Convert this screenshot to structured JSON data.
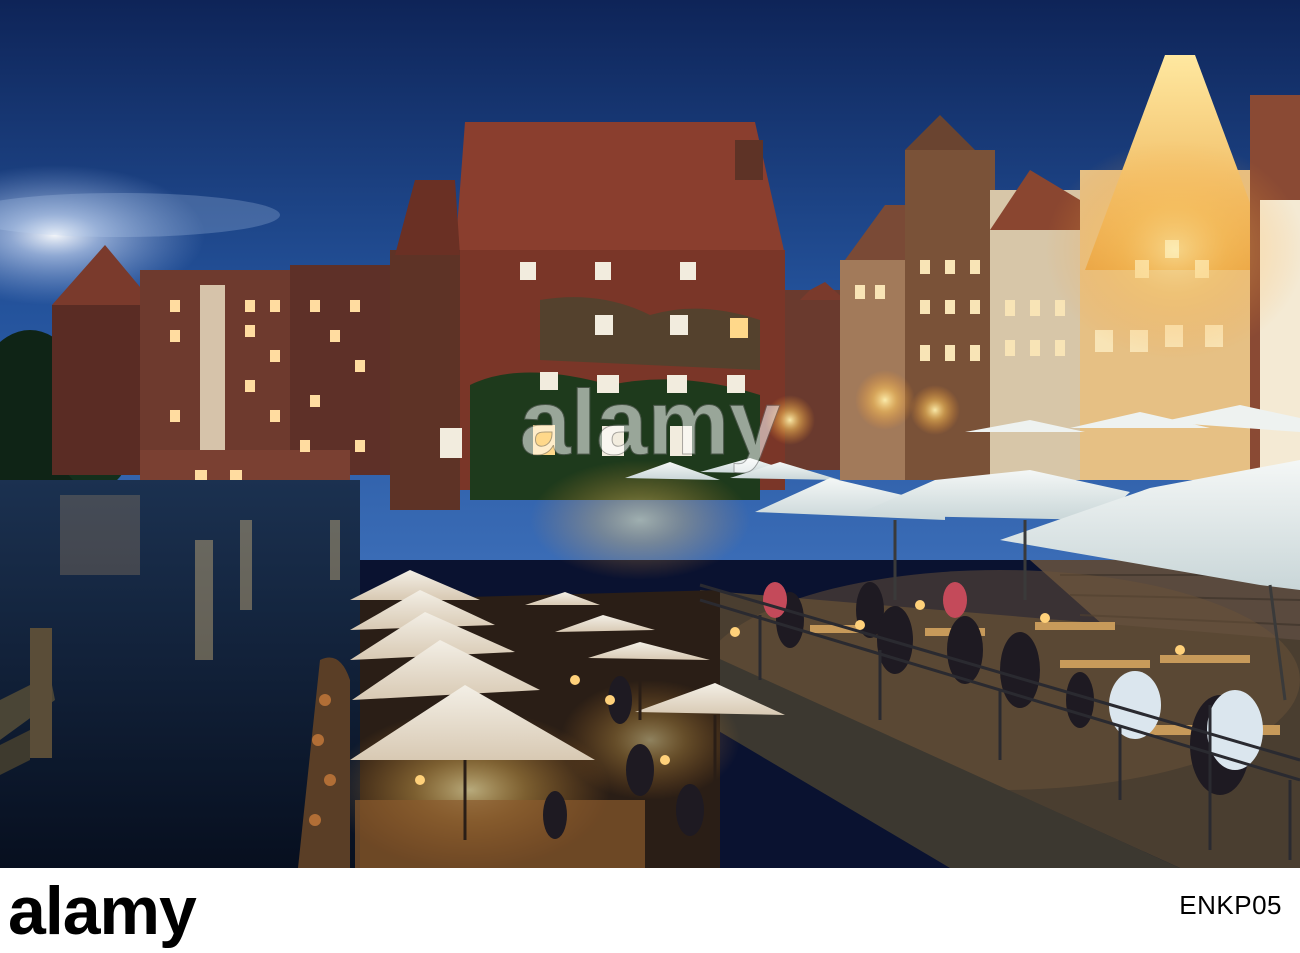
{
  "photo": {
    "subject": "night-riverside-terrace",
    "watermark_text": "alamy"
  },
  "footer": {
    "logo_text": "alamy",
    "image_id": "ENKP05"
  },
  "colors": {
    "sky_top": "#14306a",
    "sky_bottom": "#2e5ea8",
    "umbrella": "#e8eef0",
    "warm_light": "#ffd27a",
    "brick": "#6e3a2a",
    "roof": "#8a3e2e",
    "water": "#0b1b33",
    "footer_bg": "#ffffff"
  }
}
